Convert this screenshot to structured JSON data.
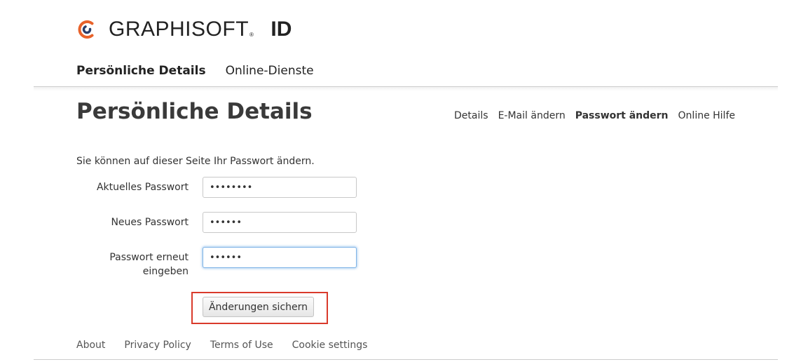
{
  "brand": {
    "name": "GRAPHISOFT",
    "registered_mark": "®",
    "product": "ID",
    "accent_color": "#e8622a",
    "logo_icon": "graphisoft-logo-icon"
  },
  "top_nav": {
    "items": [
      {
        "label": "Persönliche Details",
        "active": true
      },
      {
        "label": "Online-Dienste",
        "active": false
      }
    ]
  },
  "page": {
    "title": "Persönliche Details",
    "intro": "Sie können auf dieser Seite Ihr Passwort ändern."
  },
  "sub_nav": {
    "items": [
      {
        "label": "Details",
        "active": false
      },
      {
        "label": "E-Mail ändern",
        "active": false
      },
      {
        "label": "Passwort ändern",
        "active": true
      },
      {
        "label": "Online Hilfe",
        "active": false
      }
    ]
  },
  "form": {
    "current_password": {
      "label": "Aktuelles Passwort",
      "value": "12345678"
    },
    "new_password": {
      "label": "Neues Passwort",
      "value": "123456"
    },
    "confirm_password": {
      "label_line1": "Passwort erneut",
      "label_line2": "eingeben",
      "value": "123456"
    },
    "save_label": "Änderungen sichern",
    "highlight_color": "#d93a2b"
  },
  "footer": {
    "links": [
      "About",
      "Privacy Policy",
      "Terms of Use",
      "Cookie settings"
    ]
  }
}
